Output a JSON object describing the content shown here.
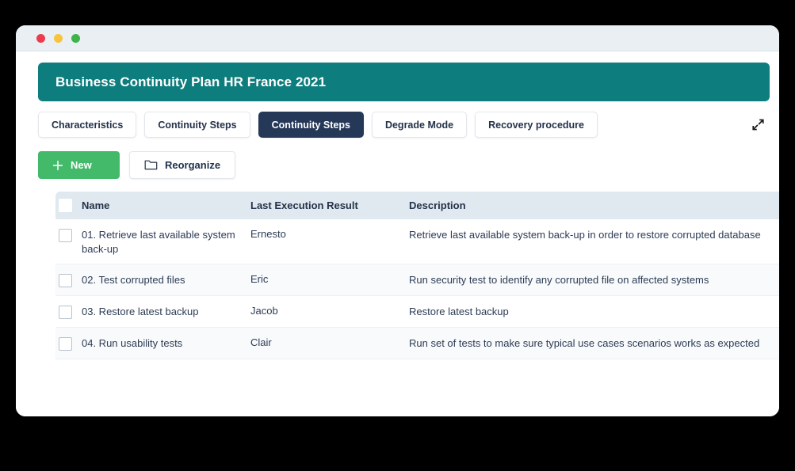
{
  "window": {
    "traffic_lights": [
      "close",
      "minimize",
      "maximize"
    ]
  },
  "header": {
    "title": "Business Continuity Plan HR France 2021",
    "background_color": "#0e7d7d"
  },
  "tabs": [
    {
      "label": "Characteristics",
      "active": false
    },
    {
      "label": "Continuity Steps",
      "active": false
    },
    {
      "label": "Continuity Steps",
      "active": true
    },
    {
      "label": "Degrade Mode",
      "active": false
    },
    {
      "label": "Recovery procedure",
      "active": false
    }
  ],
  "tab_active_color": "#253858",
  "expand_icon": "expand-arrows-icon",
  "toolbar": {
    "new_label": "New",
    "new_icon": "plus-icon",
    "new_color": "#43b96a",
    "reorganize_label": "Reorganize",
    "reorganize_icon": "folder-icon"
  },
  "table": {
    "columns": [
      "Name",
      "Last Execution Result",
      "Description"
    ],
    "header_background": "#e0e9ef",
    "rows": [
      {
        "name": "01. Retrieve last available system back-up",
        "result": "Ernesto",
        "description": "Retrieve last available system back-up in order to restore corrupted database"
      },
      {
        "name": "02. Test corrupted files",
        "result": "Eric",
        "description": "Run security test to identify any corrupted file on affected systems"
      },
      {
        "name": "03. Restore latest backup",
        "result": "Jacob",
        "description": "Restore latest backup"
      },
      {
        "name": "04. Run usability tests",
        "result": "Clair",
        "description": "Run set of tests to make sure typical use cases scenarios works as expected"
      }
    ]
  }
}
